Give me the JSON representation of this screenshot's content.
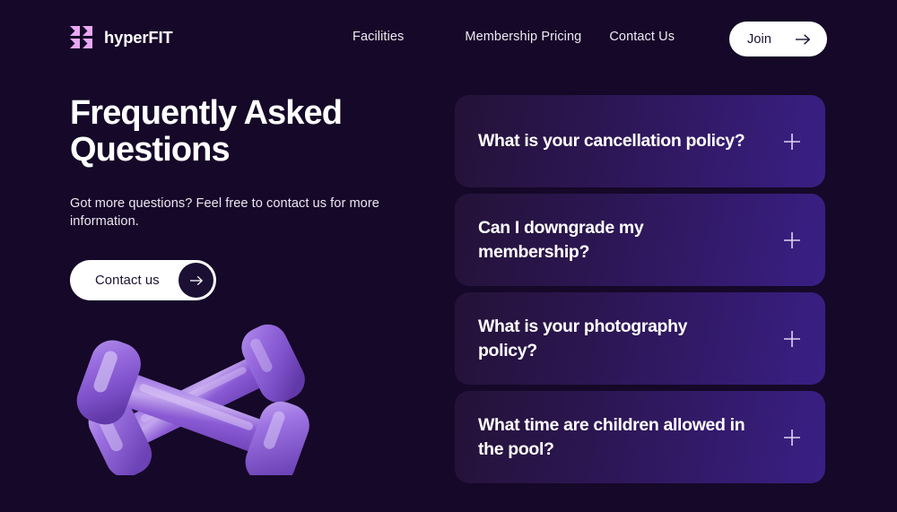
{
  "theme": {
    "background": "#150828",
    "card_gradient_start": "#241237",
    "card_gradient_end": "#3a1f85",
    "accent_pink": "#e9a8f5",
    "text_light": "#ffffff",
    "button_bg": "#ffffff",
    "button_text": "#1b1033",
    "dumbbell_purple": "#8b5fd6"
  },
  "header": {
    "logo_icon": "hyperfit-chevrons-icon",
    "brand": "hyperFIT",
    "nav": [
      {
        "label": "Facilities"
      },
      {
        "label": "Membership Pricing"
      },
      {
        "label": "Contact Us"
      }
    ],
    "join_button": {
      "label": "Join",
      "icon": "arrow-right-icon"
    }
  },
  "hero": {
    "title": "Frequently Asked Questions",
    "subtitle": "Got more questions? Feel free to contact us for more information.",
    "contact_button": {
      "label": "Contact us",
      "icon": "arrow-right-icon"
    },
    "image_alt": "purple-dumbbells-image"
  },
  "faq": {
    "toggle_icon": "plus-icon",
    "items": [
      {
        "question": "What is your cancellation policy?"
      },
      {
        "question": "Can I downgrade my membership?"
      },
      {
        "question": "What is your photography policy?"
      },
      {
        "question": "What time are children allowed in the pool?"
      }
    ]
  }
}
